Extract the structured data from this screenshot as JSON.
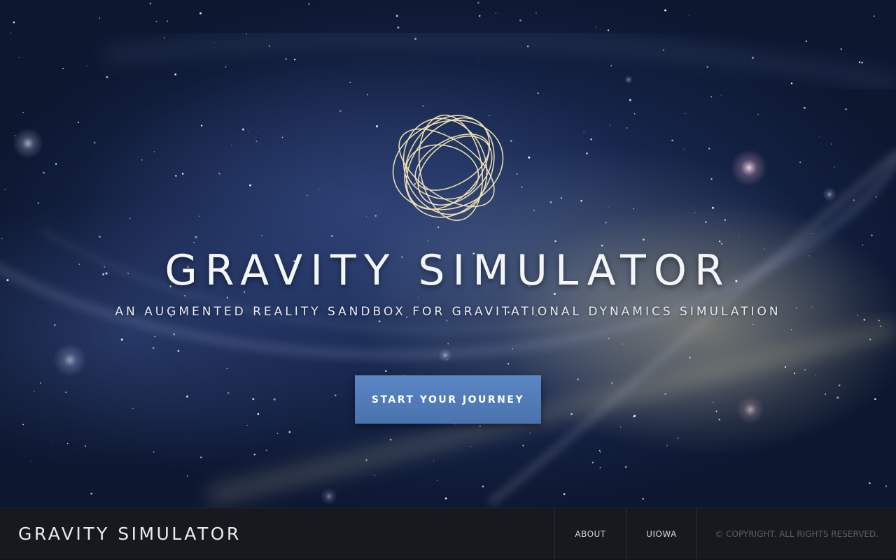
{
  "hero": {
    "logo_icon": "orbit-sphere-icon",
    "title": "GRAVITY SIMULATOR",
    "subtitle": "AN AUGMENTED REALITY SANDBOX FOR GRAVITATIONAL DYNAMICS SIMULATION",
    "cta_label": "START YOUR JOURNEY"
  },
  "footer": {
    "brand": "GRAVITY SIMULATOR",
    "nav": [
      {
        "label": "ABOUT"
      },
      {
        "label": "UIOWA"
      }
    ],
    "copyright": "© COPYRIGHT. ALL RIGHTS RESERVED."
  },
  "colors": {
    "background": "#16254a",
    "logo_gold": "#f0e2b0",
    "button": "#5079b5",
    "footer_bg": "#17191e"
  }
}
